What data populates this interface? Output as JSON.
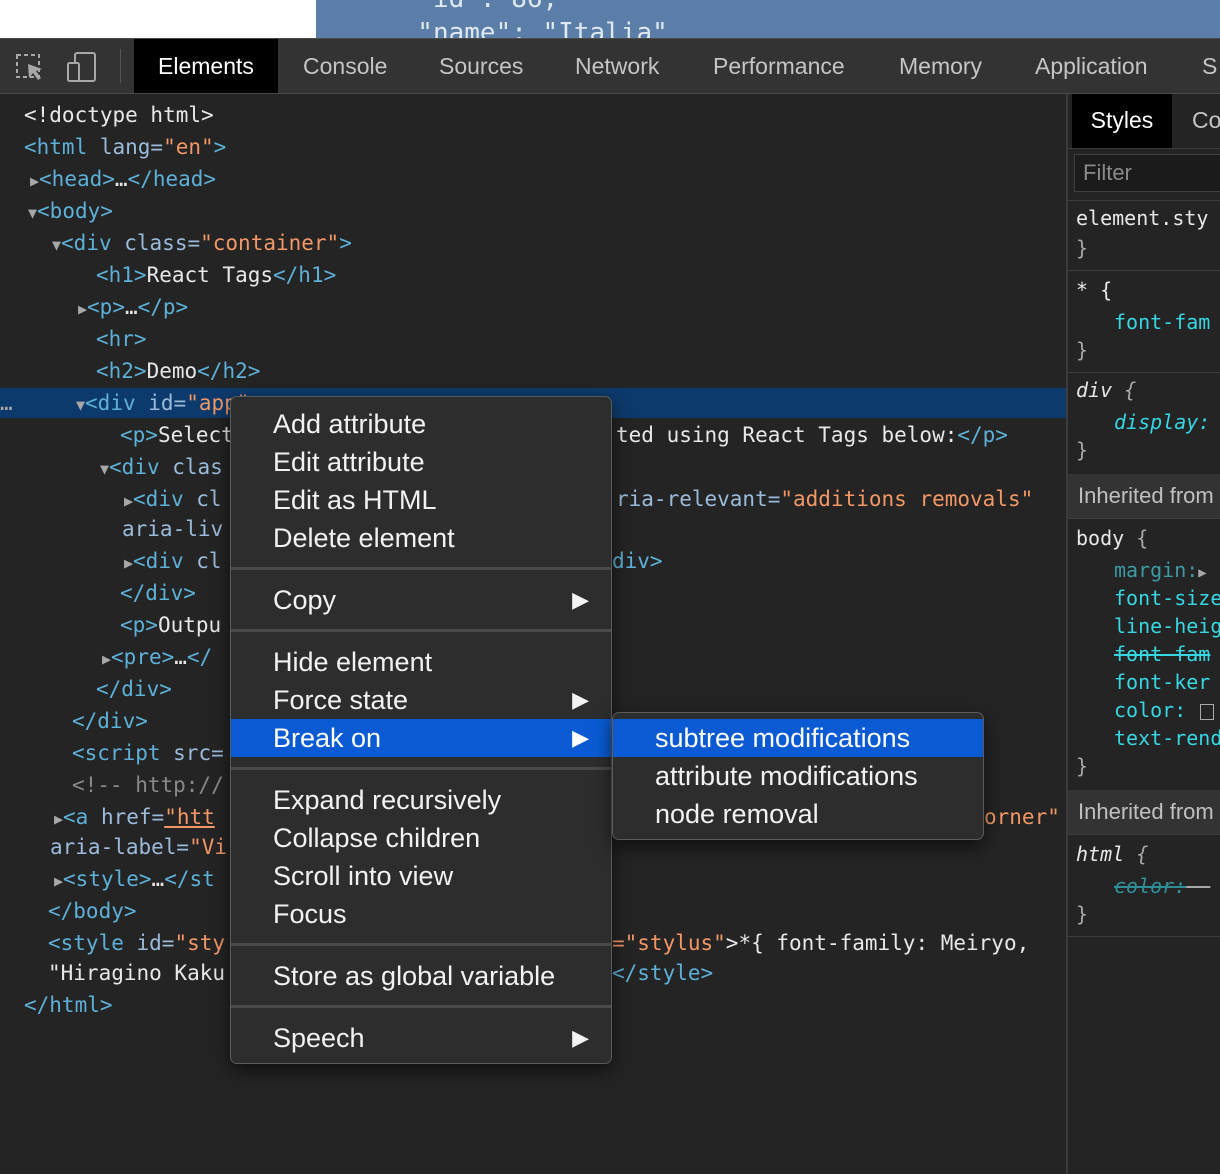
{
  "top_code": {
    "line1": "  \"id\": 86,",
    "line2": "  \"name\": \"Italia\""
  },
  "tabs": [
    "Elements",
    "Console",
    "Sources",
    "Network",
    "Performance",
    "Memory",
    "Application",
    "S"
  ],
  "dom": {
    "l1": "<!doctype html>",
    "l2_open": "<html",
    "l2_attr": " lang=",
    "l2_val": "\"en\"",
    "l2_close": ">",
    "l3": "<head>",
    "l3_e": "…",
    "l3_c": "</head>",
    "l4": "<body>",
    "l5_open": "<div",
    "l5_attr": " class=",
    "l5_val": "\"container\"",
    "l5_close": ">",
    "l6_o": "<h1>",
    "l6_t": "React Tags",
    "l6_c": "</h1>",
    "l7_o": "<p>",
    "l7_e": "…",
    "l7_c": "</p>",
    "l8": "<hr>",
    "l9_o": "<h2>",
    "l9_t": "Demo",
    "l9_c": "</h2>",
    "l10_dots": "…",
    "l10_open": "<div",
    "l10_attr": " id=",
    "l10_val": "\"app\"",
    "l11_o": "<p>",
    "l11_t": "Select",
    "l11_tail": "ted using React Tags below:",
    "l11_c": "</p>",
    "l12_open": "<div",
    "l12_attr": " clas",
    "l13_open": "<div",
    "l13_attr": " cl",
    "l13_tail_attr": "ria-relevant=",
    "l13_tail_val": "\"additions removals\"",
    "l14_attr": "aria-liv",
    "l15_open": "<div",
    "l15_attr": " cl",
    "l15_tail": "div>",
    "l16": "</div>",
    "l17_o": "<p>",
    "l17_t": "Outpu",
    "l18_o": "<pre>",
    "l18_e": "…",
    "l18_c": "</",
    "l19": "</div>",
    "l20": "</div>",
    "l21_open": "<script",
    "l21_attr": " src=",
    "l22": "<!-- http://",
    "l23_open": "<a",
    "l23_attr": " href=",
    "l23_val": "\"htt",
    "l23_tail": "orner\"",
    "l24_attr": "aria-label=",
    "l24_val": "\"Vi",
    "l25_o": "<style>",
    "l25_e": "…",
    "l25_c": "</st",
    "l26": "</body>",
    "l27_open": "<style",
    "l27_attr": " id=",
    "l27_val": "\"sty",
    "l27_tail_val": "=\"stylus\"",
    "l27_tail": ">*{ font-family: Meiryo,",
    "l28_val": "\"Hiragino Kaku",
    "l28_tail": "</style>",
    "l29": "</html>"
  },
  "styles": {
    "tab_active": "Styles",
    "tab_other": "Co",
    "filter_placeholder": "Filter",
    "r1_sel": "element.sty",
    "r1_close": "}",
    "r2_sel": "* {",
    "r2_prop": "font-fam",
    "r2_close": "}",
    "r3_sel": "div",
    "r3_brace": " {",
    "r3_prop": "display:",
    "r3_close": "}",
    "inh1": "Inherited from",
    "r4_sel": "body",
    "r4_brace": " {",
    "r4_p1": "margin:",
    "r4_p2": "font-size",
    "r4_p3": "line-heig",
    "r4_p4": "font-fam",
    "r4_p5": "font-ker",
    "r4_p6": "color:",
    "r4_p7": "text-rend",
    "r4_close": "}",
    "inh2": "Inherited from",
    "r5_sel": "html",
    "r5_brace": " {",
    "r5_p1": "color:",
    "r5_p1v": " –",
    "r5_close": "}"
  },
  "context_menu": {
    "items": [
      "Add attribute",
      "Edit attribute",
      "Edit as HTML",
      "Delete element",
      "Copy",
      "Hide element",
      "Force state",
      "Break on",
      "Expand recursively",
      "Collapse children",
      "Scroll into view",
      "Focus",
      "Store as global variable",
      "Speech"
    ],
    "highlighted": "Break on"
  },
  "submenu": {
    "items": [
      "subtree modifications",
      "attribute modifications",
      "node removal"
    ],
    "highlighted": "subtree modifications"
  },
  "colors": {
    "selection": "#0a5bd3",
    "tag": "#5db0d7",
    "attr_value": "#f29766",
    "css_property": "#36d6e3"
  }
}
